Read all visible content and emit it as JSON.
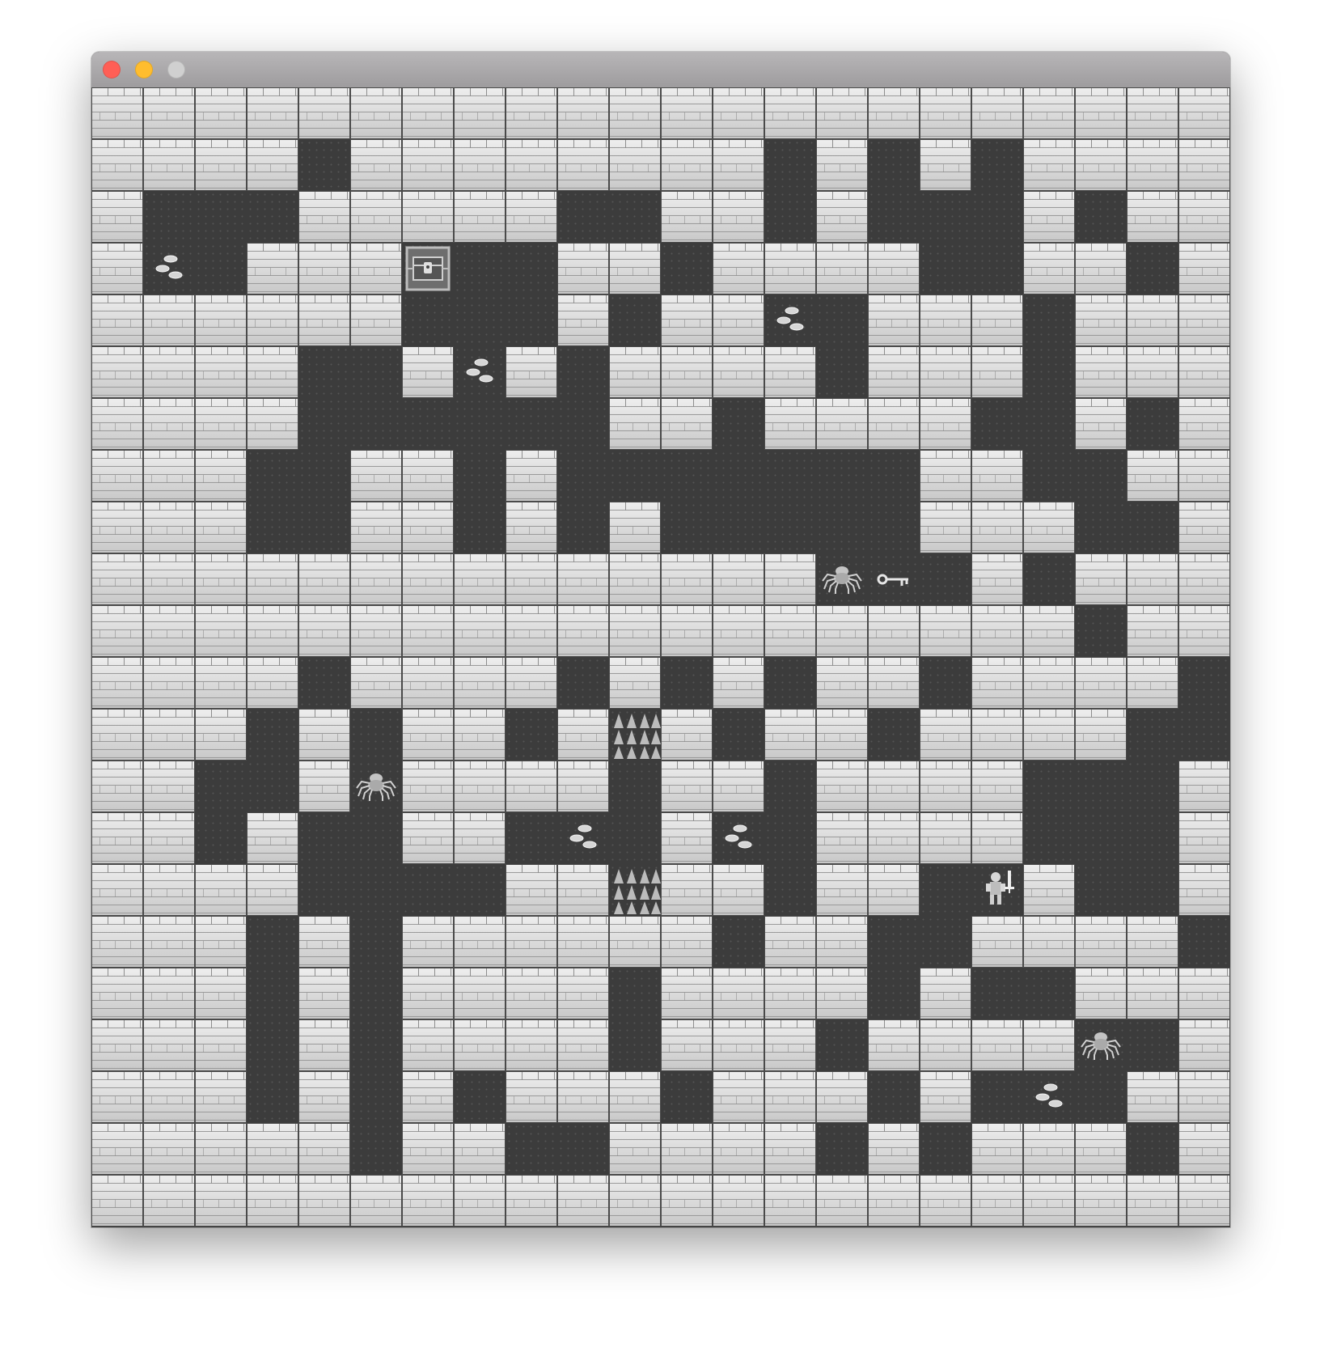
{
  "window": {
    "controls": [
      {
        "id": "close",
        "color": "#ff5f56"
      },
      {
        "id": "minimize",
        "color": "#ffbd2e"
      },
      {
        "id": "zoom",
        "color": "#d0d0d0"
      }
    ]
  },
  "map": {
    "legend": {
      "#": "wall",
      ".": "floor"
    },
    "rows": [
      "######################",
      "####.########.#.#.####",
      "#...#####..##.#...#.##",
      "#..####..##.####..##.#",
      "######...#.###.###.###",
      "####..###.####.###.###",
      "####......##.####..#.#",
      "###..##.#.......##..##",
      "###..##.#.#.....###..#",
      "##############...#.###",
      "###################.##",
      "####.####.#.#.##.####.",
      "###.#.##.#.#.##.####..",
      "##..#.####.##.####...#",
      "##.#..##.#.##.####...#",
      "####....#####.##..#..#",
      "###.#.######.##..####.",
      "###.#.####.####.#..####",
      "###.#.####.###.#####.#",
      "###.#.#.###.###.#...##",
      "#####.##..####.#.###.#",
      "######################"
    ],
    "wall_color": "#d4d4d4",
    "floor_color": "#3c3c3c"
  },
  "entities": [
    {
      "type": "treasure-chest",
      "icon": "treasure-chest-icon",
      "row": 3,
      "col": 6
    },
    {
      "type": "hero",
      "icon": "hero-icon",
      "row": 15,
      "col": 17
    },
    {
      "type": "key",
      "icon": "key-icon",
      "row": 9,
      "col": 15
    },
    {
      "type": "spider",
      "icon": "spider-icon",
      "row": 9,
      "col": 14
    },
    {
      "type": "spider",
      "icon": "spider-icon",
      "row": 13,
      "col": 5
    },
    {
      "type": "spider",
      "icon": "spider-icon",
      "row": 18,
      "col": 19
    },
    {
      "type": "coins",
      "icon": "coins-icon",
      "row": 3,
      "col": 1
    },
    {
      "type": "coins",
      "icon": "coins-icon",
      "row": 4,
      "col": 13
    },
    {
      "type": "coins",
      "icon": "coins-icon",
      "row": 5,
      "col": 7
    },
    {
      "type": "coins",
      "icon": "coins-icon",
      "row": 14,
      "col": 9
    },
    {
      "type": "coins",
      "icon": "coins-icon",
      "row": 14,
      "col": 12
    },
    {
      "type": "coins",
      "icon": "coins-icon",
      "row": 19,
      "col": 18
    },
    {
      "type": "spikes",
      "icon": "spikes-icon",
      "row": 12,
      "col": 10
    },
    {
      "type": "spikes",
      "icon": "spikes-icon",
      "row": 15,
      "col": 10
    }
  ]
}
